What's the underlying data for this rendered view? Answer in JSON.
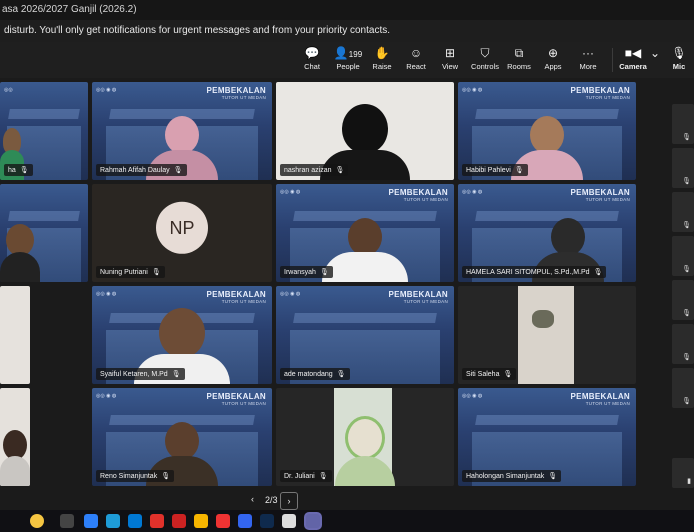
{
  "window": {
    "title": "asa 2026/2027 Ganjil (2026.2)"
  },
  "banner": {
    "text": "disturb. You'll only get notifications for urgent messages and from your priority contacts."
  },
  "toolbar": {
    "chat": "Chat",
    "people": "People",
    "people_count": "199",
    "raise": "Raise",
    "react": "React",
    "view": "View",
    "controls": "Controls",
    "rooms": "Rooms",
    "apps": "Apps",
    "more": "More",
    "camera": "Camera",
    "mic": "Mic"
  },
  "slide": {
    "title": "PEMBEKALAN",
    "subtitle": "TUTOR UT MEDAN"
  },
  "participants": {
    "p0": "ha",
    "p1": "Rahmah Afifah Daulay",
    "p2": "nashran azizan",
    "p3": "Habibi Pahlevi",
    "p4": "",
    "p5": "Nuning Putriani",
    "p5_initials": "NP",
    "p6": "Irwansyah",
    "p7": "HAMELA SARI SITOMPUL, S.Pd.,M.Pd",
    "p8": "",
    "p9": "Syaiful Ketaren, M.Pd",
    "p10": "ade matondang",
    "p11": "Siti Saleha",
    "p12": "",
    "p13": "Reno Simanjuntak",
    "p14": "Dr. Juliani",
    "p15": "Haholongan Simanjuntak"
  },
  "pager": {
    "page": "2/3",
    "prev": "‹",
    "next": "›"
  },
  "colors": {
    "accent": "#6264a7",
    "background": "#1b1b1b",
    "slide_blue": "#2a4070"
  }
}
